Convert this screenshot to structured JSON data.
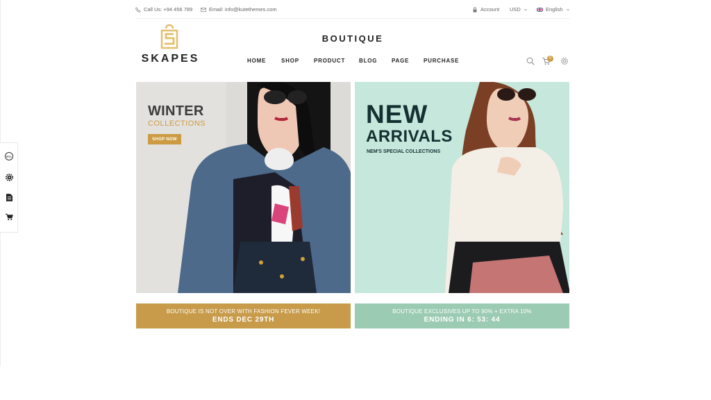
{
  "topbar": {
    "phone": "Call Us: +94 456 789",
    "email": "Email: info@kutethemes.com",
    "account": "Account",
    "currency": "USD",
    "language": "English"
  },
  "logo": {
    "word": "SKAPES",
    "mark_letter": "S"
  },
  "header": {
    "title": "BOUTIQUE"
  },
  "nav": [
    "HOME",
    "SHOP",
    "PRODUCT",
    "BLOG",
    "PAGE",
    "PURCHASE"
  ],
  "cart": {
    "count": "0"
  },
  "banners": {
    "left": {
      "title": "WINTER",
      "subtitle": "COLLECTIONS",
      "button": "SHOP NOW"
    },
    "right": {
      "title1": "NEW",
      "title2": "ARRIVALS",
      "subtitle": "NEM'S SPECIAL COLLECTIONS"
    }
  },
  "promos": {
    "left": {
      "line1": "BOUTIQUE IS NOT OVER WITH FASHION FEVER WEEK!",
      "line2": "ENDS DEC 29TH"
    },
    "right": {
      "line1": "BOUTIQUE EXCLUSIVES UP TO 90% + EXTRA 10%",
      "line2": "ENDING IN 6: 53: 44"
    }
  },
  "sidebar": {
    "rtl": "RTL"
  },
  "icons": [
    "phone-icon",
    "email-icon",
    "lock-icon",
    "flag-icon",
    "chevron-down-icon",
    "search-icon",
    "cart-icon",
    "gear-icon",
    "document-icon"
  ],
  "colors": {
    "accent": "#cc9b43",
    "promo_left": "#c79b4a",
    "promo_right": "#9ccbb3",
    "mint": "#c6e7db",
    "dark_teal": "#143031"
  }
}
